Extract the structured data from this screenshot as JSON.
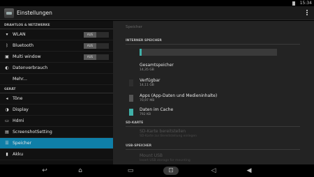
{
  "status": {
    "time": "15:34"
  },
  "app": {
    "title": "Einstellungen"
  },
  "left": {
    "section_wireless": "DRAHTLOS & NETZWERKE",
    "wlan": {
      "label": "WLAN",
      "toggle": "AUS"
    },
    "bluetooth": {
      "label": "Bluetooth",
      "toggle": "AUS"
    },
    "multiwindow": {
      "label": "Multi window",
      "toggle": "AUS"
    },
    "datausage": "Datenverbrauch",
    "more": "Mehr...",
    "section_device": "GERÄT",
    "sound": "Töne",
    "display": "Display",
    "hdmi": "Hdmi",
    "screenshot": "ScreenshotSetting",
    "storage": "Speicher",
    "battery": "Akku"
  },
  "right": {
    "header": "Speicher",
    "internal_section": "INTERNER SPEICHER",
    "total": {
      "title": "Gesamtspeicher",
      "value": "14,35 GB"
    },
    "available": {
      "title": "Verfügbar",
      "value": "14,11 GB"
    },
    "apps": {
      "title": "Apps (App-Daten und Medieninhalte)",
      "value": "70,97 MB"
    },
    "cache": {
      "title": "Daten im Cache",
      "value": "792 KB"
    },
    "sd_section": "SD-KARTE",
    "sd_unmount": {
      "title": "SD-Karte bereitstellen",
      "value": "SD-Karte zur Bereitstellung einlegen"
    },
    "usb_section": "USB-SPEICHER",
    "usb_mount": {
      "title": "Mount USB",
      "value": "Insert USB storage for mounting"
    }
  },
  "colors": {
    "accent": "#0f7fa8",
    "cache": "#40b0a8",
    "apps": "#555555"
  },
  "usage_fraction": 0.017
}
